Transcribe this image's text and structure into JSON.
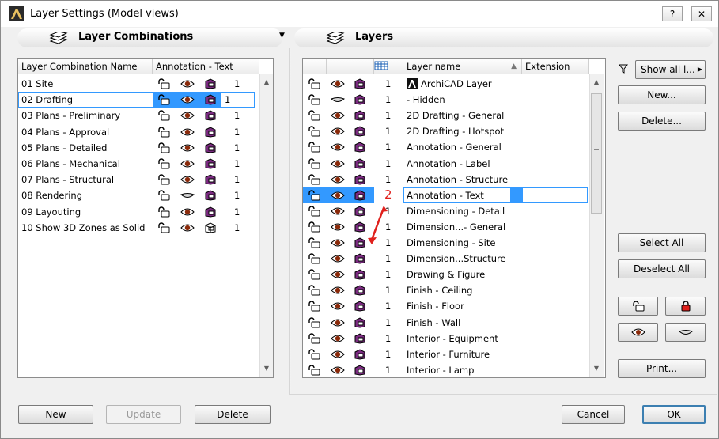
{
  "window": {
    "title": "Layer Settings (Model views)",
    "help_label": "?",
    "close_label": "✕"
  },
  "left": {
    "title": "Layer Combinations",
    "col_name": "Layer Combination Name",
    "col_ann": "Annotation - Text",
    "rows": [
      {
        "name": "01 Site",
        "lock": "unlocked",
        "vis": "eye",
        "mode": "solid",
        "num": "1"
      },
      {
        "name": "02 Drafting",
        "lock": "unlocked",
        "vis": "eye",
        "mode": "solid",
        "num": "1",
        "selected": true
      },
      {
        "name": "03 Plans - Preliminary",
        "lock": "unlocked",
        "vis": "eye",
        "mode": "solid",
        "num": "1"
      },
      {
        "name": "04 Plans - Approval",
        "lock": "unlocked",
        "vis": "eye",
        "mode": "solid",
        "num": "1"
      },
      {
        "name": "05 Plans - Detailed",
        "lock": "unlocked",
        "vis": "eye",
        "mode": "solid",
        "num": "1"
      },
      {
        "name": "06 Plans - Mechanical",
        "lock": "unlocked",
        "vis": "eye",
        "mode": "solid",
        "num": "1"
      },
      {
        "name": "07 Plans - Structural",
        "lock": "unlocked",
        "vis": "eye",
        "mode": "solid",
        "num": "1"
      },
      {
        "name": "08 Rendering",
        "lock": "unlocked",
        "vis": "hidden",
        "mode": "solid",
        "num": "1"
      },
      {
        "name": "09 Layouting",
        "lock": "unlocked",
        "vis": "eye",
        "mode": "solid",
        "num": "1"
      },
      {
        "name": "10 Show 3D Zones as Solid",
        "lock": "unlocked",
        "vis": "eye",
        "mode": "wire",
        "num": "1"
      }
    ],
    "buttons": {
      "new": "New",
      "update": "Update",
      "delete": "Delete"
    }
  },
  "right": {
    "title": "Layers",
    "col_name": "Layer name",
    "col_ext": "Extension",
    "editing_value": "2",
    "rows": [
      {
        "name": "ArchiCAD Layer",
        "lock": "unlocked",
        "vis": "eye",
        "mode": "solid",
        "num": "1",
        "logo": true
      },
      {
        "name": "- Hidden",
        "lock": "unlocked",
        "vis": "hidden",
        "mode": "solid",
        "num": "1"
      },
      {
        "name": "2D Drafting - General",
        "lock": "unlocked",
        "vis": "eye",
        "mode": "solid",
        "num": "1"
      },
      {
        "name": "2D Drafting - Hotspot",
        "lock": "unlocked",
        "vis": "eye",
        "mode": "solid",
        "num": "1"
      },
      {
        "name": "Annotation - General",
        "lock": "unlocked",
        "vis": "eye",
        "mode": "solid",
        "num": "1"
      },
      {
        "name": "Annotation - Label",
        "lock": "unlocked",
        "vis": "eye",
        "mode": "solid",
        "num": "1"
      },
      {
        "name": "Annotation - Structure",
        "lock": "unlocked",
        "vis": "eye",
        "mode": "solid",
        "num": "1"
      },
      {
        "name": "Annotation - Text",
        "lock": "unlocked",
        "vis": "eye",
        "mode": "solid",
        "num": "",
        "selected": true
      },
      {
        "name": "Dimensioning - Detail",
        "lock": "unlocked",
        "vis": "eye",
        "mode": "solid",
        "num": "1"
      },
      {
        "name": "Dimension...- General",
        "lock": "unlocked",
        "vis": "eye",
        "mode": "solid",
        "num": "1"
      },
      {
        "name": "Dimensioning - Site",
        "lock": "unlocked",
        "vis": "eye",
        "mode": "solid",
        "num": "1"
      },
      {
        "name": "Dimension...Structure",
        "lock": "unlocked",
        "vis": "eye",
        "mode": "solid",
        "num": "1"
      },
      {
        "name": "Drawing & Figure",
        "lock": "unlocked",
        "vis": "eye",
        "mode": "solid",
        "num": "1"
      },
      {
        "name": "Finish - Ceiling",
        "lock": "unlocked",
        "vis": "eye",
        "mode": "solid",
        "num": "1"
      },
      {
        "name": "Finish - Floor",
        "lock": "unlocked",
        "vis": "eye",
        "mode": "solid",
        "num": "1"
      },
      {
        "name": "Finish - Wall",
        "lock": "unlocked",
        "vis": "eye",
        "mode": "solid",
        "num": "1"
      },
      {
        "name": "Interior - Equipment",
        "lock": "unlocked",
        "vis": "eye",
        "mode": "solid",
        "num": "1"
      },
      {
        "name": "Interior - Furniture",
        "lock": "unlocked",
        "vis": "eye",
        "mode": "solid",
        "num": "1"
      },
      {
        "name": "Interior - Lamp",
        "lock": "unlocked",
        "vis": "eye",
        "mode": "solid",
        "num": "1"
      }
    ]
  },
  "side": {
    "filter_label": "Show all l...",
    "new": "New...",
    "delete": "Delete...",
    "select_all": "Select All",
    "deselect_all": "Deselect All",
    "print": "Print..."
  },
  "footer": {
    "cancel": "Cancel",
    "ok": "OK"
  },
  "colors": {
    "selection": "#3399ff",
    "accent_red": "#e0201c",
    "icon_purple": "#7a2a80"
  }
}
